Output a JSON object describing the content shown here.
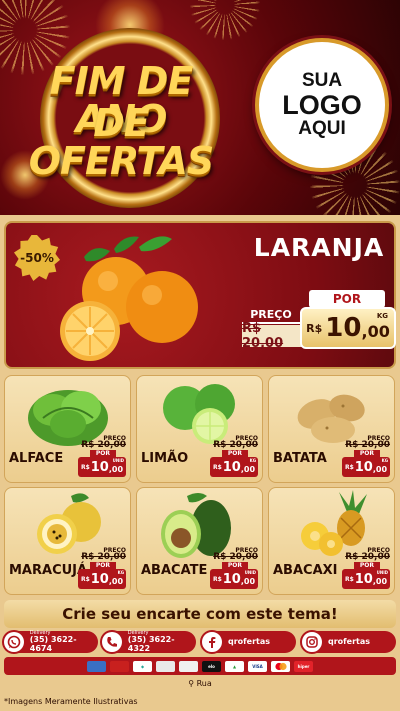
{
  "header": {
    "title_line1": "FIM DE ANO",
    "title_line2": "DE OFERTAS",
    "logo_lines": [
      "SUA",
      "LOGO",
      "AQUI"
    ]
  },
  "featured": {
    "badge": "-50%",
    "name": "LARANJA",
    "price_label": "PREÇO",
    "old_price": "R$ 20,00",
    "por_label": "POR",
    "currency": "R$",
    "price_int": "10",
    "price_dec": ",00",
    "unit": "KG",
    "image_icon": "orange-icon"
  },
  "products": [
    {
      "name": "ALFACE",
      "price_label": "PREÇO",
      "old_price": "R$ 20,00",
      "por_label": "POR",
      "currency": "R$",
      "price_int": "10",
      "price_dec": ",00",
      "unit": "UNID",
      "icon": "lettuce-icon"
    },
    {
      "name": "LIMÃO",
      "price_label": "PREÇO",
      "old_price": "R$ 20,00",
      "por_label": "POR",
      "currency": "R$",
      "price_int": "10",
      "price_dec": ",00",
      "unit": "KG",
      "icon": "lime-icon"
    },
    {
      "name": "BATATA",
      "price_label": "PREÇO",
      "old_price": "R$ 20,00",
      "por_label": "POR",
      "currency": "R$",
      "price_int": "10",
      "price_dec": ",00",
      "unit": "KG",
      "icon": "potato-icon"
    },
    {
      "name": "MARACUJÁ",
      "price_label": "PREÇO",
      "old_price": "R$ 20,00",
      "por_label": "POR",
      "currency": "R$",
      "price_int": "10",
      "price_dec": ",00",
      "unit": "KG",
      "icon": "passionfruit-icon"
    },
    {
      "name": "ABACATE",
      "price_label": "PREÇO",
      "old_price": "R$ 20,00",
      "por_label": "POR",
      "currency": "R$",
      "price_int": "10",
      "price_dec": ",00",
      "unit": "UNID",
      "icon": "avocado-icon"
    },
    {
      "name": "ABACAXI",
      "price_label": "PREÇO",
      "old_price": "R$ 20,00",
      "por_label": "POR",
      "currency": "R$",
      "price_int": "10",
      "price_dec": ",00",
      "unit": "UNID",
      "icon": "pineapple-icon"
    }
  ],
  "cta": "Crie seu encarte com este tema!",
  "contacts": [
    {
      "label": "Delivery",
      "value": "(35) 3622-4674",
      "icon": "whatsapp-icon"
    },
    {
      "label": "Delivery",
      "value": "(35) 3622-4322",
      "icon": "phone-icon"
    },
    {
      "label": "",
      "value": "qrofertas",
      "icon": "facebook-icon"
    },
    {
      "label": "",
      "value": "qrofertas",
      "icon": "instagram-icon"
    }
  ],
  "payments": [
    "card",
    "card",
    "pix",
    "card",
    "card",
    "elo",
    "card",
    "VISA",
    "master",
    "hiper"
  ],
  "address": "Rua",
  "disclaimer": "*Imagens Meramente Ilustrativas",
  "colors": {
    "primary_red": "#b0151b",
    "gold": "#ffd659",
    "cream": "#f6e3b7"
  }
}
